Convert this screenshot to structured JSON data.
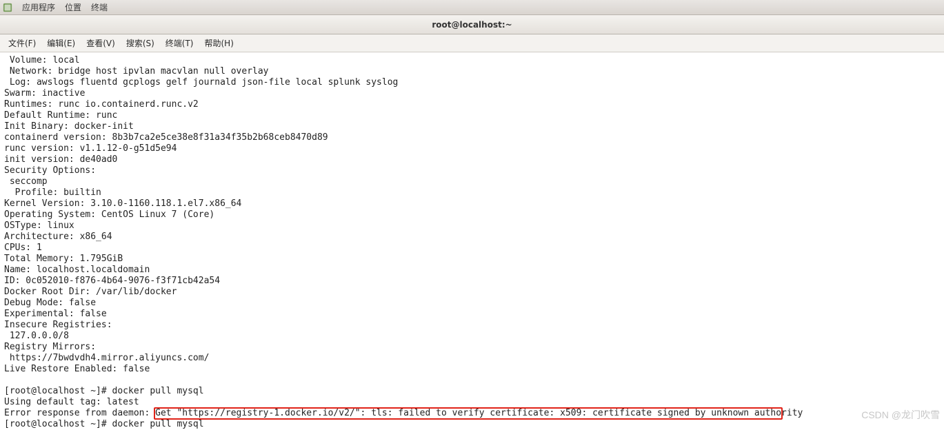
{
  "top_panel": {
    "menu_apps": "应用程序",
    "menu_places": "位置",
    "menu_terminal": "终端"
  },
  "title_bar": {
    "title": "root@localhost:~"
  },
  "menu_bar": {
    "file": "文件(F)",
    "edit": "编辑(E)",
    "view": "查看(V)",
    "search": "搜索(S)",
    "terminal": "终端(T)",
    "help": "帮助(H)"
  },
  "watermark": "CSDN @龙门吹雪",
  "terminal": {
    "lines": [
      " Volume: local",
      " Network: bridge host ipvlan macvlan null overlay",
      " Log: awslogs fluentd gcplogs gelf journald json-file local splunk syslog",
      "Swarm: inactive",
      "Runtimes: runc io.containerd.runc.v2",
      "Default Runtime: runc",
      "Init Binary: docker-init",
      "containerd version: 8b3b7ca2e5ce38e8f31a34f35b2b68ceb8470d89",
      "runc version: v1.1.12-0-g51d5e94",
      "init version: de40ad0",
      "Security Options:",
      " seccomp",
      "  Profile: builtin",
      "Kernel Version: 3.10.0-1160.118.1.el7.x86_64",
      "Operating System: CentOS Linux 7 (Core)",
      "OSType: linux",
      "Architecture: x86_64",
      "CPUs: 1",
      "Total Memory: 1.795GiB",
      "Name: localhost.localdomain",
      "ID: 0c052010-f876-4b64-9076-f3f71cb42a54",
      "Docker Root Dir: /var/lib/docker",
      "Debug Mode: false",
      "Experimental: false",
      "Insecure Registries:",
      " 127.0.0.0/8",
      "Registry Mirrors:",
      " https://7bwdvdh4.mirror.aliyuncs.com/",
      "Live Restore Enabled: false",
      "",
      "[root@localhost ~]# docker pull mysql",
      "Using default tag: latest",
      "Error response from daemon: Get \"https://registry-1.docker.io/v2/\": tls: failed to verify certificate: x509: certificate signed by unknown authority",
      "[root@localhost ~]# docker pull mysql"
    ],
    "highlight": {
      "line_index": 32,
      "col_start": 28,
      "col_end": 144
    }
  }
}
